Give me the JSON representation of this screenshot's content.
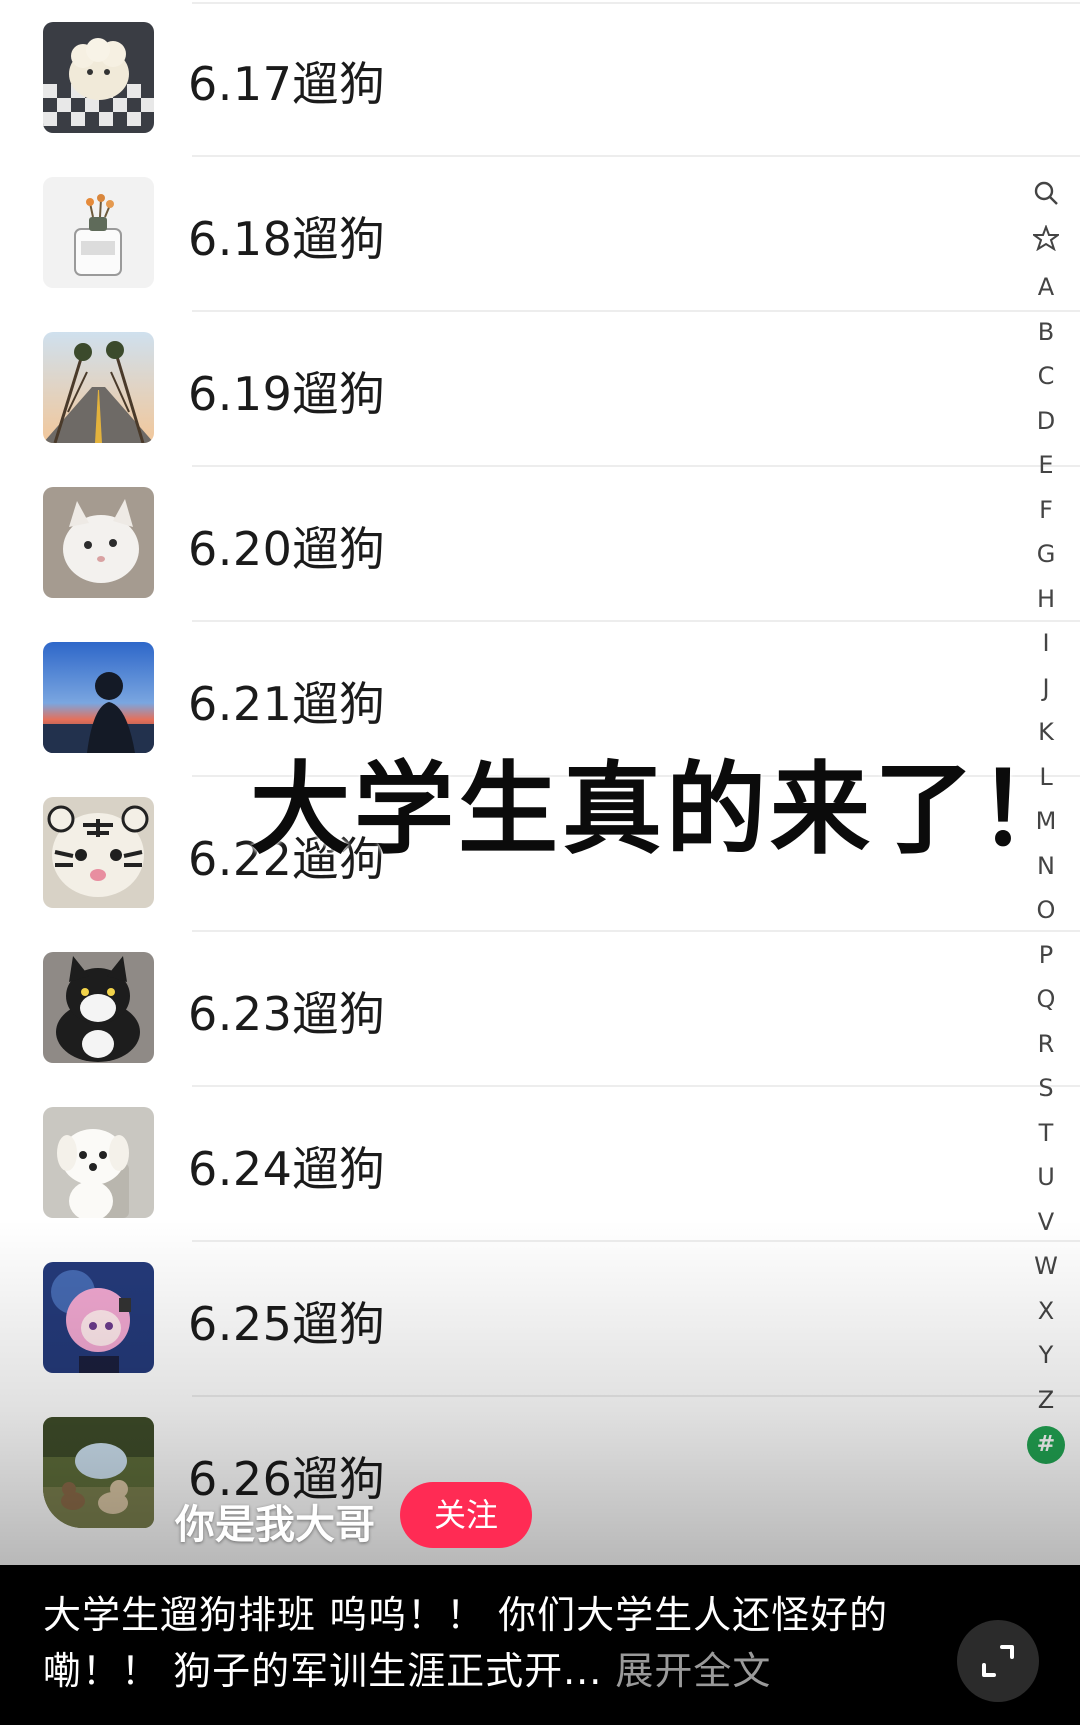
{
  "contacts": [
    {
      "name": "6.17遛狗",
      "avatar_icon": "plush-sheep-avatar-icon"
    },
    {
      "name": "6.18遛狗",
      "avatar_icon": "candle-jar-avatar-icon"
    },
    {
      "name": "6.19遛狗",
      "avatar_icon": "palm-road-avatar-icon"
    },
    {
      "name": "6.20遛狗",
      "avatar_icon": "white-cat-avatar-icon"
    },
    {
      "name": "6.21遛狗",
      "avatar_icon": "sunset-silhouette-avatar-icon"
    },
    {
      "name": "6.22遛狗",
      "avatar_icon": "tiger-plush-avatar-icon"
    },
    {
      "name": "6.23遛狗",
      "avatar_icon": "black-cat-plush-avatar-icon"
    },
    {
      "name": "6.24遛狗",
      "avatar_icon": "white-dog-avatar-icon"
    },
    {
      "name": "6.25遛狗",
      "avatar_icon": "anime-girl-avatar-icon"
    },
    {
      "name": "6.26遛狗",
      "avatar_icon": "dogs-garden-avatar-icon"
    }
  ],
  "index_bar": [
    "A",
    "B",
    "C",
    "D",
    "E",
    "F",
    "G",
    "H",
    "I",
    "J",
    "K",
    "L",
    "M",
    "N",
    "O",
    "P",
    "Q",
    "R",
    "S",
    "T",
    "U",
    "V",
    "W",
    "X",
    "Y",
    "Z"
  ],
  "index_hash": "#",
  "overlay_title": "大学生真的来了！",
  "author": {
    "name": "你是我大哥",
    "follow_label": "关注"
  },
  "caption": {
    "text": "大学生遛狗排班 呜呜！！ 你们大学生人还怪好的嘞！！ 狗子的军训生涯正式开...",
    "expand_label": "展开全文"
  },
  "colors": {
    "follow": "#ff2b54",
    "hash_badge": "#22a553"
  }
}
